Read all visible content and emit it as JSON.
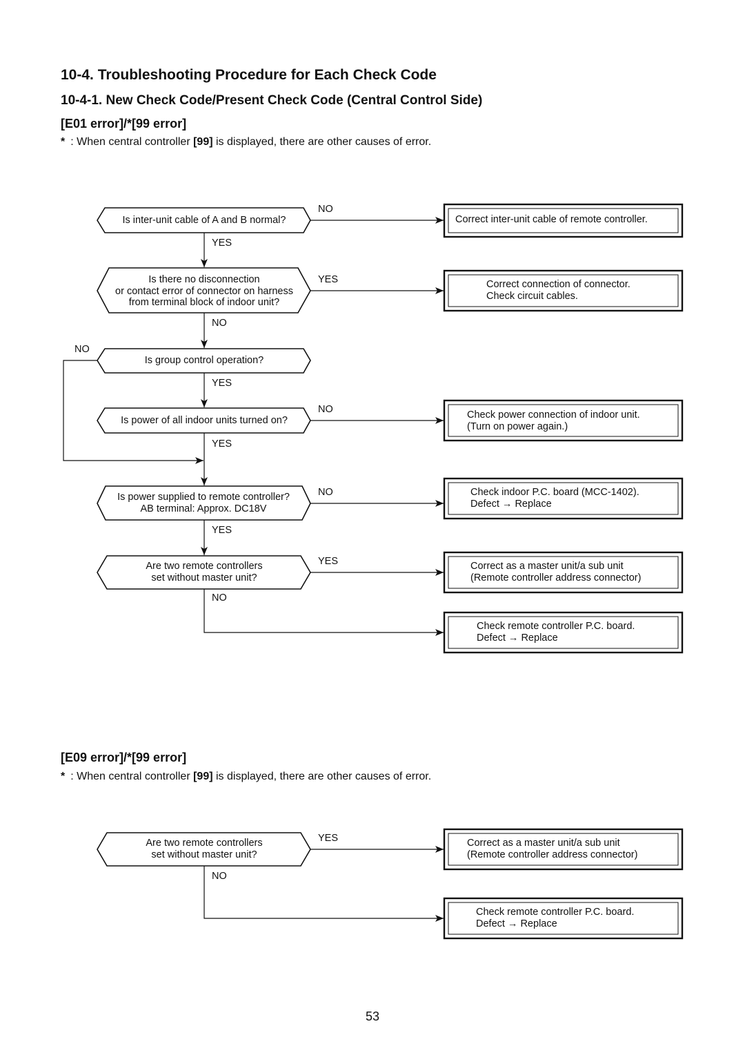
{
  "section_title": "10-4.  Troubleshooting Procedure for Each Check Code",
  "subsection_title": "10-4-1.  New Check Code/Present Check Code (Central Control Side)",
  "flowcharts": [
    {
      "heading": "[E01 error]/*[99 error]",
      "note": {
        "marker": "*",
        "prefix": ": When central controller ",
        "bold": "[99]",
        "suffix": " is displayed, there are other causes of error."
      },
      "questions": [
        {
          "lines": [
            "Is inter-unit cable of A and B normal?"
          ],
          "down_label": "YES",
          "right_label": "NO"
        },
        {
          "lines": [
            "Is there no disconnection",
            "or contact error of connector on harness",
            "from terminal block of indoor unit?"
          ],
          "down_label": "NO",
          "right_label": "YES"
        },
        {
          "lines": [
            "Is group control operation?"
          ],
          "down_label": "YES",
          "left_label": "NO"
        },
        {
          "lines": [
            "Is power of all indoor units turned on?"
          ],
          "down_label": "YES",
          "right_label": "NO"
        },
        {
          "lines": [
            "Is power supplied to remote controller?",
            "AB terminal: Approx. DC18V"
          ],
          "down_label": "YES",
          "right_label": "NO"
        },
        {
          "lines": [
            "Are two remote controllers",
            "set without master unit?"
          ],
          "down_label": "NO",
          "right_label": "YES"
        }
      ],
      "results": [
        {
          "lines": [
            "Correct inter-unit cable of remote controller."
          ]
        },
        {
          "lines": [
            "Correct connection of connector.",
            "Check circuit cables."
          ]
        },
        {
          "lines": [
            "Check power connection of indoor unit.",
            "(Turn on power again.)"
          ]
        },
        {
          "lines": [
            "Check indoor P.C. board (MCC-1402).",
            "Defect → Replace"
          ]
        },
        {
          "lines": [
            "Correct as a master unit/a sub unit",
            "(Remote controller address connector)"
          ]
        },
        {
          "lines": [
            "Check remote controller P.C. board.",
            "Defect → Replace"
          ]
        }
      ]
    },
    {
      "heading": "[E09 error]/*[99 error]",
      "note": {
        "marker": "*",
        "prefix": ": When central controller ",
        "bold": "[99]",
        "suffix": " is displayed, there are other causes of error."
      },
      "questions": [
        {
          "lines": [
            "Are two remote controllers",
            "set without master unit?"
          ],
          "down_label": "NO",
          "right_label": "YES"
        }
      ],
      "results": [
        {
          "lines": [
            "Correct as a master unit/a sub unit",
            "(Remote controller address connector)"
          ]
        },
        {
          "lines": [
            "Check remote controller P.C. board.",
            "Defect → Replace"
          ]
        }
      ]
    }
  ],
  "page_number": "53"
}
